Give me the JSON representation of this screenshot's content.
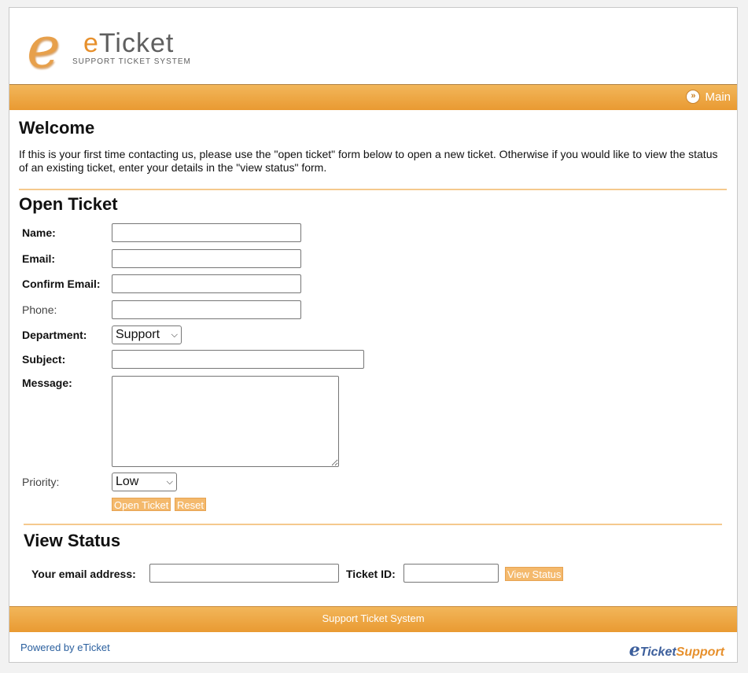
{
  "header": {
    "logo_letter": "e",
    "logo_brand_e": "e",
    "logo_brand_rest": "Ticket",
    "logo_tagline": "SUPPORT TICKET SYSTEM"
  },
  "nav": {
    "main_label": "Main",
    "main_icon": "double-chevron-right-icon"
  },
  "welcome": {
    "title": "Welcome",
    "text": "If this is your first time contacting us, please use the \"open ticket\" form below to open a new ticket. Otherwise if you would like to view the status of an existing ticket, enter your details in the \"view status\" form."
  },
  "open_ticket": {
    "title": "Open Ticket",
    "labels": {
      "name": "Name:",
      "email": "Email:",
      "confirm_email": "Confirm Email:",
      "phone": "Phone:",
      "department": "Department:",
      "subject": "Subject:",
      "message": "Message:",
      "priority": "Priority:"
    },
    "values": {
      "name": "",
      "email": "",
      "confirm_email": "",
      "phone": "",
      "subject": "",
      "message": ""
    },
    "department_selected": "Support",
    "priority_selected": "Low",
    "open_button": "Open Ticket",
    "reset_button": "Reset"
  },
  "view_status": {
    "title": "View Status",
    "email_label": "Your email address:",
    "ticket_label": "Ticket ID:",
    "button": "View Status"
  },
  "footer": {
    "bar_text": "Support Ticket System",
    "powered": "Powered by eTicket",
    "brand_e": "e",
    "brand_ticket": "Ticket",
    "brand_support": "Support"
  },
  "colors": {
    "accent": "#e99a32",
    "link": "#2a5f9e",
    "button": "#f4b96c"
  }
}
